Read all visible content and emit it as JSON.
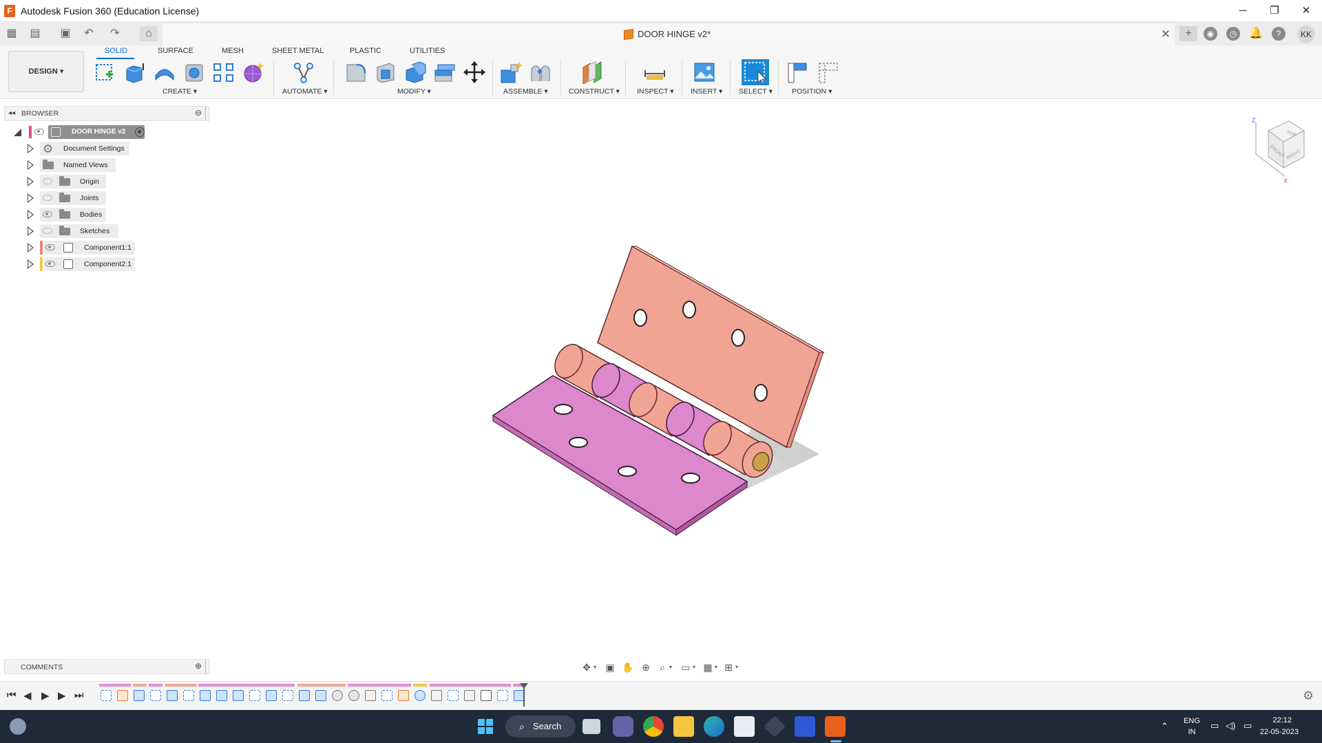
{
  "window": {
    "title": "Autodesk Fusion 360 (Education License)",
    "logo_letter": "F",
    "minimize": "─",
    "maximize": "❐",
    "close": "✕"
  },
  "quick_access": {
    "doc_title": "DOOR HINGE v2*",
    "close_tab": "✕",
    "user_initials": "KK"
  },
  "ribbon": {
    "workspace": "DESIGN ▾",
    "tabs": [
      "SOLID",
      "SURFACE",
      "MESH",
      "SHEET METAL",
      "PLASTIC",
      "UTILITIES"
    ],
    "active_tab": "SOLID",
    "groups": [
      "CREATE ▾",
      "AUTOMATE ▾",
      "MODIFY ▾",
      "ASSEMBLE ▾",
      "CONSTRUCT ▾",
      "INSPECT ▾",
      "INSERT ▾",
      "SELECT ▾",
      "POSITION ▾"
    ]
  },
  "browser": {
    "title": "BROWSER",
    "root": "DOOR HINGE v2",
    "items": [
      {
        "label": "Document Settings",
        "icon": "gear-icon"
      },
      {
        "label": "Named Views",
        "icon": "folder-icon"
      },
      {
        "label": "Origin",
        "icon": "folder-icon"
      },
      {
        "label": "Joints",
        "icon": "folder-icon"
      },
      {
        "label": "Bodies",
        "icon": "folder-icon"
      },
      {
        "label": "Sketches",
        "icon": "folder-icon"
      },
      {
        "label": "Component1:1",
        "icon": "component-icon",
        "tag_color": "#f08080"
      },
      {
        "label": "Component2:1",
        "icon": "component-icon",
        "tag_color": "#f5c542"
      }
    ]
  },
  "comments": {
    "title": "COMMENTS"
  },
  "viewcube": {
    "top": "TOP",
    "front": "FRONT",
    "right": "RIGHT",
    "axis_z": "Z",
    "axis_x": "X"
  },
  "model": {
    "leaf_a_color": "#f2a494",
    "leaf_b_color": "#dd87cc",
    "pin_color": "#c9a24a"
  },
  "taskbar": {
    "search": "Search",
    "lang": "ENG",
    "region": "IN",
    "time": "22:12",
    "date": "22-05-2023"
  },
  "colors": {
    "accent": "#0a6fd0",
    "taskbar": "#1e2a38"
  }
}
